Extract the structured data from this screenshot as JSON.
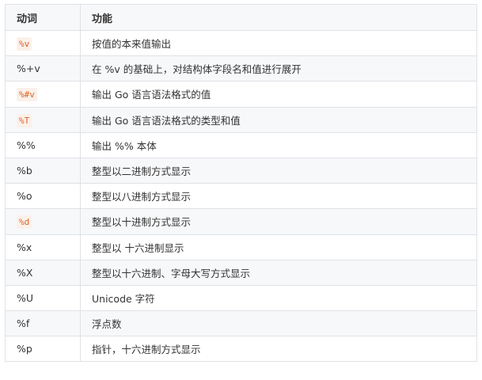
{
  "headers": [
    "动词",
    "功能"
  ],
  "rows": [
    {
      "verb": "%v",
      "desc": "按值的本来值输出",
      "code": true
    },
    {
      "verb": "%+v",
      "desc": "在 %v 的基础上，对结构体字段名和值进行展开",
      "code": false
    },
    {
      "verb": "%#v",
      "desc": "输出 Go 语言语法格式的值",
      "code": true
    },
    {
      "verb": "%T",
      "desc": "输出 Go 语言语法格式的类型和值",
      "code": true
    },
    {
      "verb": "%%",
      "desc": "输出 %% 本体",
      "code": false
    },
    {
      "verb": "%b",
      "desc": "整型以二进制方式显示",
      "code": false
    },
    {
      "verb": "%o",
      "desc": "整型以八进制方式显示",
      "code": false
    },
    {
      "verb": "%d",
      "desc": "整型以十进制方式显示",
      "code": true
    },
    {
      "verb": "%x",
      "desc": "整型以 十六进制显示",
      "code": false
    },
    {
      "verb": "%X",
      "desc": "整型以十六进制、字母大写方式显示",
      "code": false
    },
    {
      "verb": "%U",
      "desc": "Unicode 字符",
      "code": false
    },
    {
      "verb": "%f",
      "desc": "浮点数",
      "code": false
    },
    {
      "verb": "%p",
      "desc": "指针，十六进制方式显示",
      "code": false
    }
  ]
}
